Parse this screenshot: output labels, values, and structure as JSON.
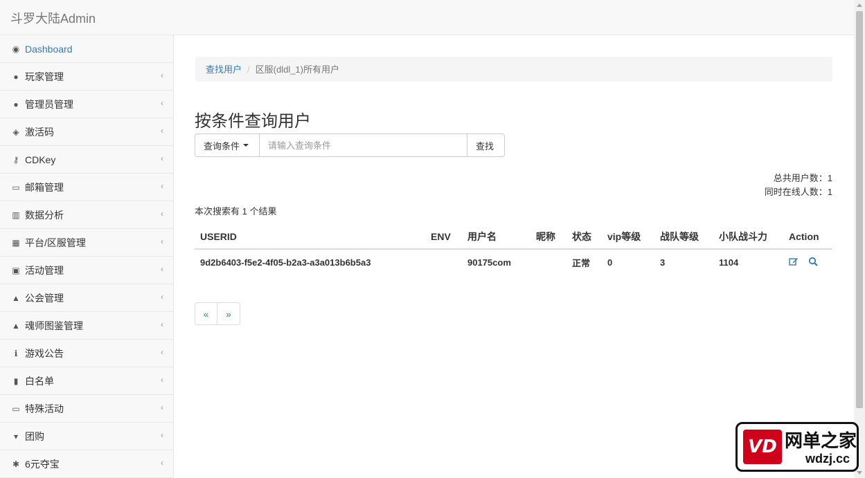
{
  "app": {
    "brand": "斗罗大陆Admin"
  },
  "sidebar": {
    "items": [
      {
        "label": "Dashboard",
        "icon": "dashboard-icon",
        "glyph": "◉"
      },
      {
        "label": "玩家管理",
        "icon": "user-icon",
        "glyph": "●"
      },
      {
        "label": "管理员管理",
        "icon": "users-icon",
        "glyph": "●"
      },
      {
        "label": "激活码",
        "icon": "cube-icon",
        "glyph": "◈"
      },
      {
        "label": "CDKey",
        "icon": "key-icon",
        "glyph": "⚷"
      },
      {
        "label": "邮箱管理",
        "icon": "inbox-icon",
        "glyph": "▭"
      },
      {
        "label": "数据分析",
        "icon": "bar-chart-icon",
        "glyph": "▥"
      },
      {
        "label": "平台/区服管理",
        "icon": "bank-icon",
        "glyph": "▦"
      },
      {
        "label": "活动管理",
        "icon": "gift-icon",
        "glyph": "▣"
      },
      {
        "label": "公会管理",
        "icon": "sitemap-icon",
        "glyph": "▲"
      },
      {
        "label": "魂师图鉴管理",
        "icon": "sitemap-icon",
        "glyph": "▲"
      },
      {
        "label": "游戏公告",
        "icon": "info-icon",
        "glyph": "ℹ"
      },
      {
        "label": "白名单",
        "icon": "file-icon",
        "glyph": "▮"
      },
      {
        "label": "特殊活动",
        "icon": "money-icon",
        "glyph": "▭"
      },
      {
        "label": "团购",
        "icon": "cart-icon",
        "glyph": "▾"
      },
      {
        "label": "6元夺宝",
        "icon": "asterisk-icon",
        "glyph": "✱"
      }
    ],
    "chevron": "‹"
  },
  "breadcrumb": {
    "link": "查找用户",
    "separator": "/",
    "current": "区服(dldl_1)所有用户"
  },
  "page": {
    "title": "按条件查询用户"
  },
  "search": {
    "dropdown_label": "查询条件",
    "placeholder": "请输入查询条件",
    "button_label": "查找"
  },
  "stats": {
    "total_users": "总共用户数：1",
    "online_users": "同时在线人数：1"
  },
  "result_text": "本次搜索有 1 个结果",
  "table": {
    "headers": [
      "USERID",
      "ENV",
      "用户名",
      "昵称",
      "状态",
      "vip等级",
      "战队等级",
      "小队战斗力",
      "Action"
    ],
    "rows": [
      {
        "userid": "9d2b6403-f5e2-4f05-b2a3-a3a013b6b5a3",
        "env": "",
        "username": "90175com",
        "nickname": "",
        "status": "正常",
        "vip": "0",
        "team_level": "3",
        "power": "1104"
      }
    ]
  },
  "pagination": {
    "prev": "«",
    "next": "»"
  },
  "watermark": {
    "logo_text": "VD",
    "name": "网单之家",
    "url": "wdzj.cc"
  },
  "colors": {
    "link": "#337ab7",
    "sidebar_bg": "#f8f8f8",
    "watermark_red": "#d0021b"
  }
}
